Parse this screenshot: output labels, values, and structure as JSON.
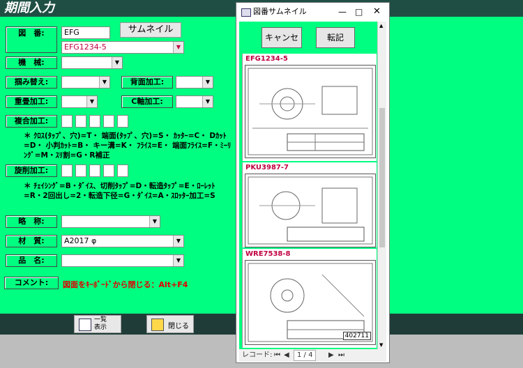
{
  "window_title": "期間入力",
  "form": {
    "zuban_label": "図　番:",
    "zuban_value": "EFG",
    "zuban_combo": "EFG1234-5",
    "thumbnail_button": "サムネイル",
    "kikai_label": "機　械:",
    "tsukamikae_label": "掴み替え:",
    "haimen_label": "背面加工:",
    "juuten_label": "重畳加工:",
    "c_axis_label": "C軸加工:",
    "fukugou_label": "複合加工:",
    "fukugou_note": "＊ ｸﾛｽ(ﾀｯﾌﾟ、穴)=T・ 端面(ﾀｯﾌﾟ、穴)=S・ ｶｯﾀｰ=C・ Dｶｯﾄ=D・ 小判ｶｯﾄ=B・ キー溝=K・ ﾌﾗｲｽ=E・ 端面ﾌﾗｲｽ=F・ﾐｰﾘﾝｸﾞ=M・ｽﾘ割=G・R補正",
    "senkaku_label": "旋削加工:",
    "senkaku_note": "＊ ﾁｪｲｼﾝｸﾞ=B・ﾀﾞｲｽ、切削ﾀｯﾌﾟ=D・転造ﾀｯﾌﾟ=E・ﾛｰﾚｯﾄ=R・2回出し=2・転造下径=G・ﾀﾞｲｽ=A・ｽﾛｯﾀｰ加工=S",
    "ryakushou_label": "略　称:",
    "zaishitsu_label": "材　質:",
    "zaishitsu_value": "A2017 φ",
    "hinmei_label": "品　名:",
    "comment_label": "コメント:",
    "comment_hint": "図面をｷｰﾎﾞｰﾄﾞから閉じる：Alt+F4"
  },
  "footer": {
    "list_button": "一覧\n表示",
    "close_button": "閉じる"
  },
  "popup": {
    "title": "図番サムネイル",
    "cancel_button": "キャンセル",
    "transfer_button": "転記",
    "records": [
      {
        "label": "EFG1234-5"
      },
      {
        "label": "PKU3987-7"
      },
      {
        "label": "WRE7538-8"
      }
    ],
    "drawing_stamp": "402711",
    "nav_label": "レコード:",
    "nav_position": "1 / 4"
  }
}
